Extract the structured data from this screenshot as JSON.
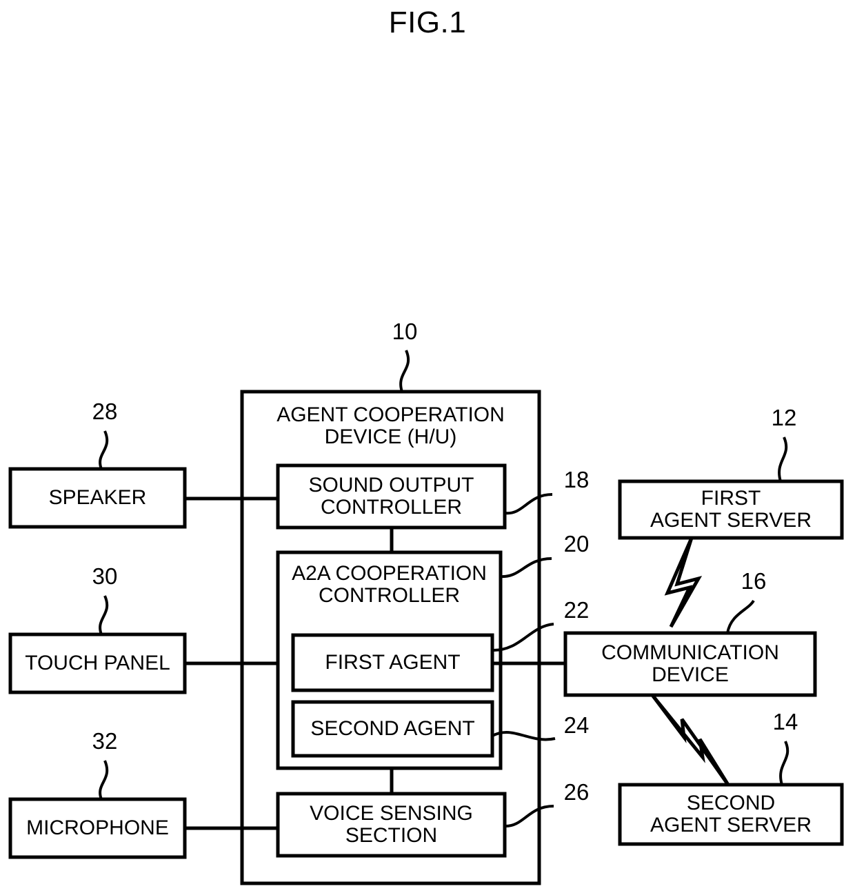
{
  "figure": {
    "title": "FIG.1"
  },
  "boxes": {
    "agent_cooperation_device": {
      "label": "AGENT COOPERATION\nDEVICE (H/U)",
      "ref": "10"
    },
    "sound_output_controller": {
      "label": "SOUND OUTPUT\nCONTROLLER",
      "ref": "18"
    },
    "a2a_cooperation_controller": {
      "label": "A2A COOPERATION\nCONTROLLER",
      "ref": "20"
    },
    "first_agent": {
      "label": "FIRST AGENT",
      "ref": "22"
    },
    "second_agent": {
      "label": "SECOND AGENT",
      "ref": "24"
    },
    "voice_sensing_section": {
      "label": "VOICE SENSING\nSECTION",
      "ref": "26"
    },
    "speaker": {
      "label": "SPEAKER",
      "ref": "28"
    },
    "touch_panel": {
      "label": "TOUCH PANEL",
      "ref": "30"
    },
    "microphone": {
      "label": "MICROPHONE",
      "ref": "32"
    },
    "first_agent_server": {
      "label": "FIRST\nAGENT SERVER",
      "ref": "12"
    },
    "second_agent_server": {
      "label": "SECOND\nAGENT SERVER",
      "ref": "14"
    },
    "communication_device": {
      "label": "COMMUNICATION\nDEVICE",
      "ref": "16"
    }
  },
  "colors": {
    "stroke": "#000000",
    "background": "#ffffff"
  }
}
